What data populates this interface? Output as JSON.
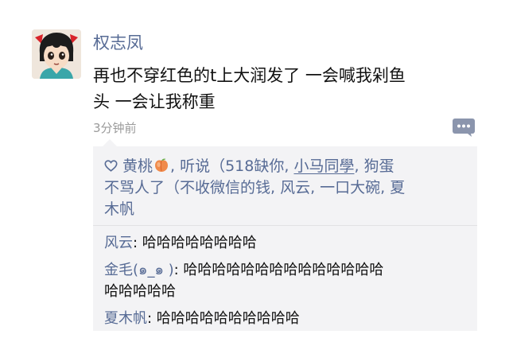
{
  "post": {
    "author": "权志凤",
    "content_lines": [
      "再也不穿红色的t上大润发了 一会喊我剁鱼",
      "头 一会让我称重"
    ],
    "time": "3分钟前"
  },
  "likes": {
    "line1_a": "黄桃",
    "line1_b": ", 听说（518缺你, ",
    "line1_c": "小马同學",
    "line1_d": ", 狗蛋",
    "line2": "不骂人了（不收微信的钱, 风云, 一口大碗, 夏",
    "line3": "木帆"
  },
  "comments": [
    {
      "name": "风云",
      "sep": ": ",
      "text_lines": [
        "哈哈哈哈哈哈哈哈"
      ]
    },
    {
      "name": "金毛(๑_๑ )",
      "sep": ": ",
      "text_lines": [
        "哈哈哈哈哈哈哈哈哈哈哈哈哈哈",
        "哈哈哈哈哈"
      ]
    },
    {
      "name": "夏木帆",
      "sep": ": ",
      "text_lines": [
        "哈哈哈哈哈哈哈哈哈哈"
      ]
    }
  ],
  "colors": {
    "link": "#576b95",
    "text": "#111111",
    "muted": "#9a9a9a",
    "panel": "#f3f3f5"
  },
  "icons": {
    "like": "heart-outline-icon",
    "emoji": "peach-emoji-icon",
    "comment": "comment-bubble-icon"
  }
}
